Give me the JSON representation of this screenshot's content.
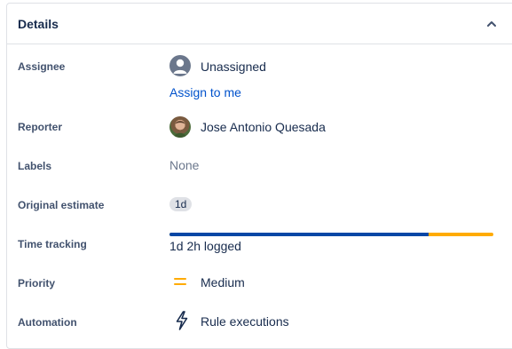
{
  "panel": {
    "title": "Details",
    "collapse_icon": "chevron-up-icon"
  },
  "fields": {
    "assignee": {
      "label": "Assignee",
      "value": "Unassigned",
      "avatar_icon": "user-placeholder-icon",
      "action": "Assign to me"
    },
    "reporter": {
      "label": "Reporter",
      "value": "Jose Antonio Quesada",
      "avatar_icon": "user-avatar"
    },
    "labels": {
      "label": "Labels",
      "value": "None"
    },
    "original_estimate": {
      "label": "Original estimate",
      "value": "1d"
    },
    "time_tracking": {
      "label": "Time tracking",
      "logged_text": "1d 2h logged",
      "logged_fraction": 0.8,
      "logged_color": "#0747a6",
      "over_color": "#ffab00"
    },
    "priority": {
      "label": "Priority",
      "value": "Medium",
      "icon": "priority-medium-icon",
      "icon_color": "#ffab00"
    },
    "automation": {
      "label": "Automation",
      "value": "Rule executions",
      "icon": "lightning-bolt-icon"
    }
  },
  "colors": {
    "link": "#0052cc",
    "text": "#172b4d",
    "label": "#42526e",
    "muted": "#6b778c",
    "border": "#dfe1e6"
  }
}
